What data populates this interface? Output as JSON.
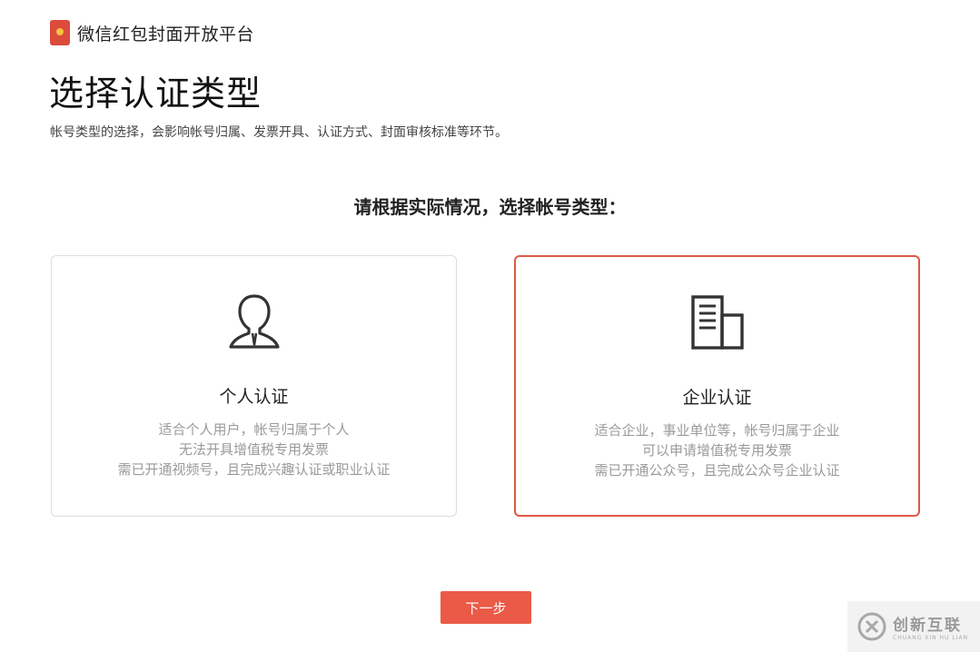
{
  "header": {
    "brand": "微信红包封面开放平台"
  },
  "page": {
    "title": "选择认证类型",
    "subtitle": "帐号类型的选择，会影响帐号归属、发票开具、认证方式、封面审核标准等环节。",
    "prompt": "请根据实际情况，选择帐号类型："
  },
  "cards": [
    {
      "title": "个人认证",
      "icon": "person-icon",
      "lines": [
        "适合个人用户，帐号归属于个人",
        "无法开具增值税专用发票",
        "需已开通视频号，且完成兴趣认证或职业认证"
      ],
      "selected": false
    },
    {
      "title": "企业认证",
      "icon": "building-icon",
      "lines": [
        "适合企业，事业单位等，帐号归属于企业",
        "可以申请增值税专用发票",
        "需已开通公众号，且完成公众号企业认证"
      ],
      "selected": true
    }
  ],
  "actions": {
    "next_label": "下一步"
  },
  "watermark": {
    "main": "创新互联",
    "sub": "CHUANG XIN HU LIAN"
  },
  "colors": {
    "accent": "#ea5a47",
    "selected_border": "#dc5a45",
    "logo": "#dc4b3c"
  }
}
